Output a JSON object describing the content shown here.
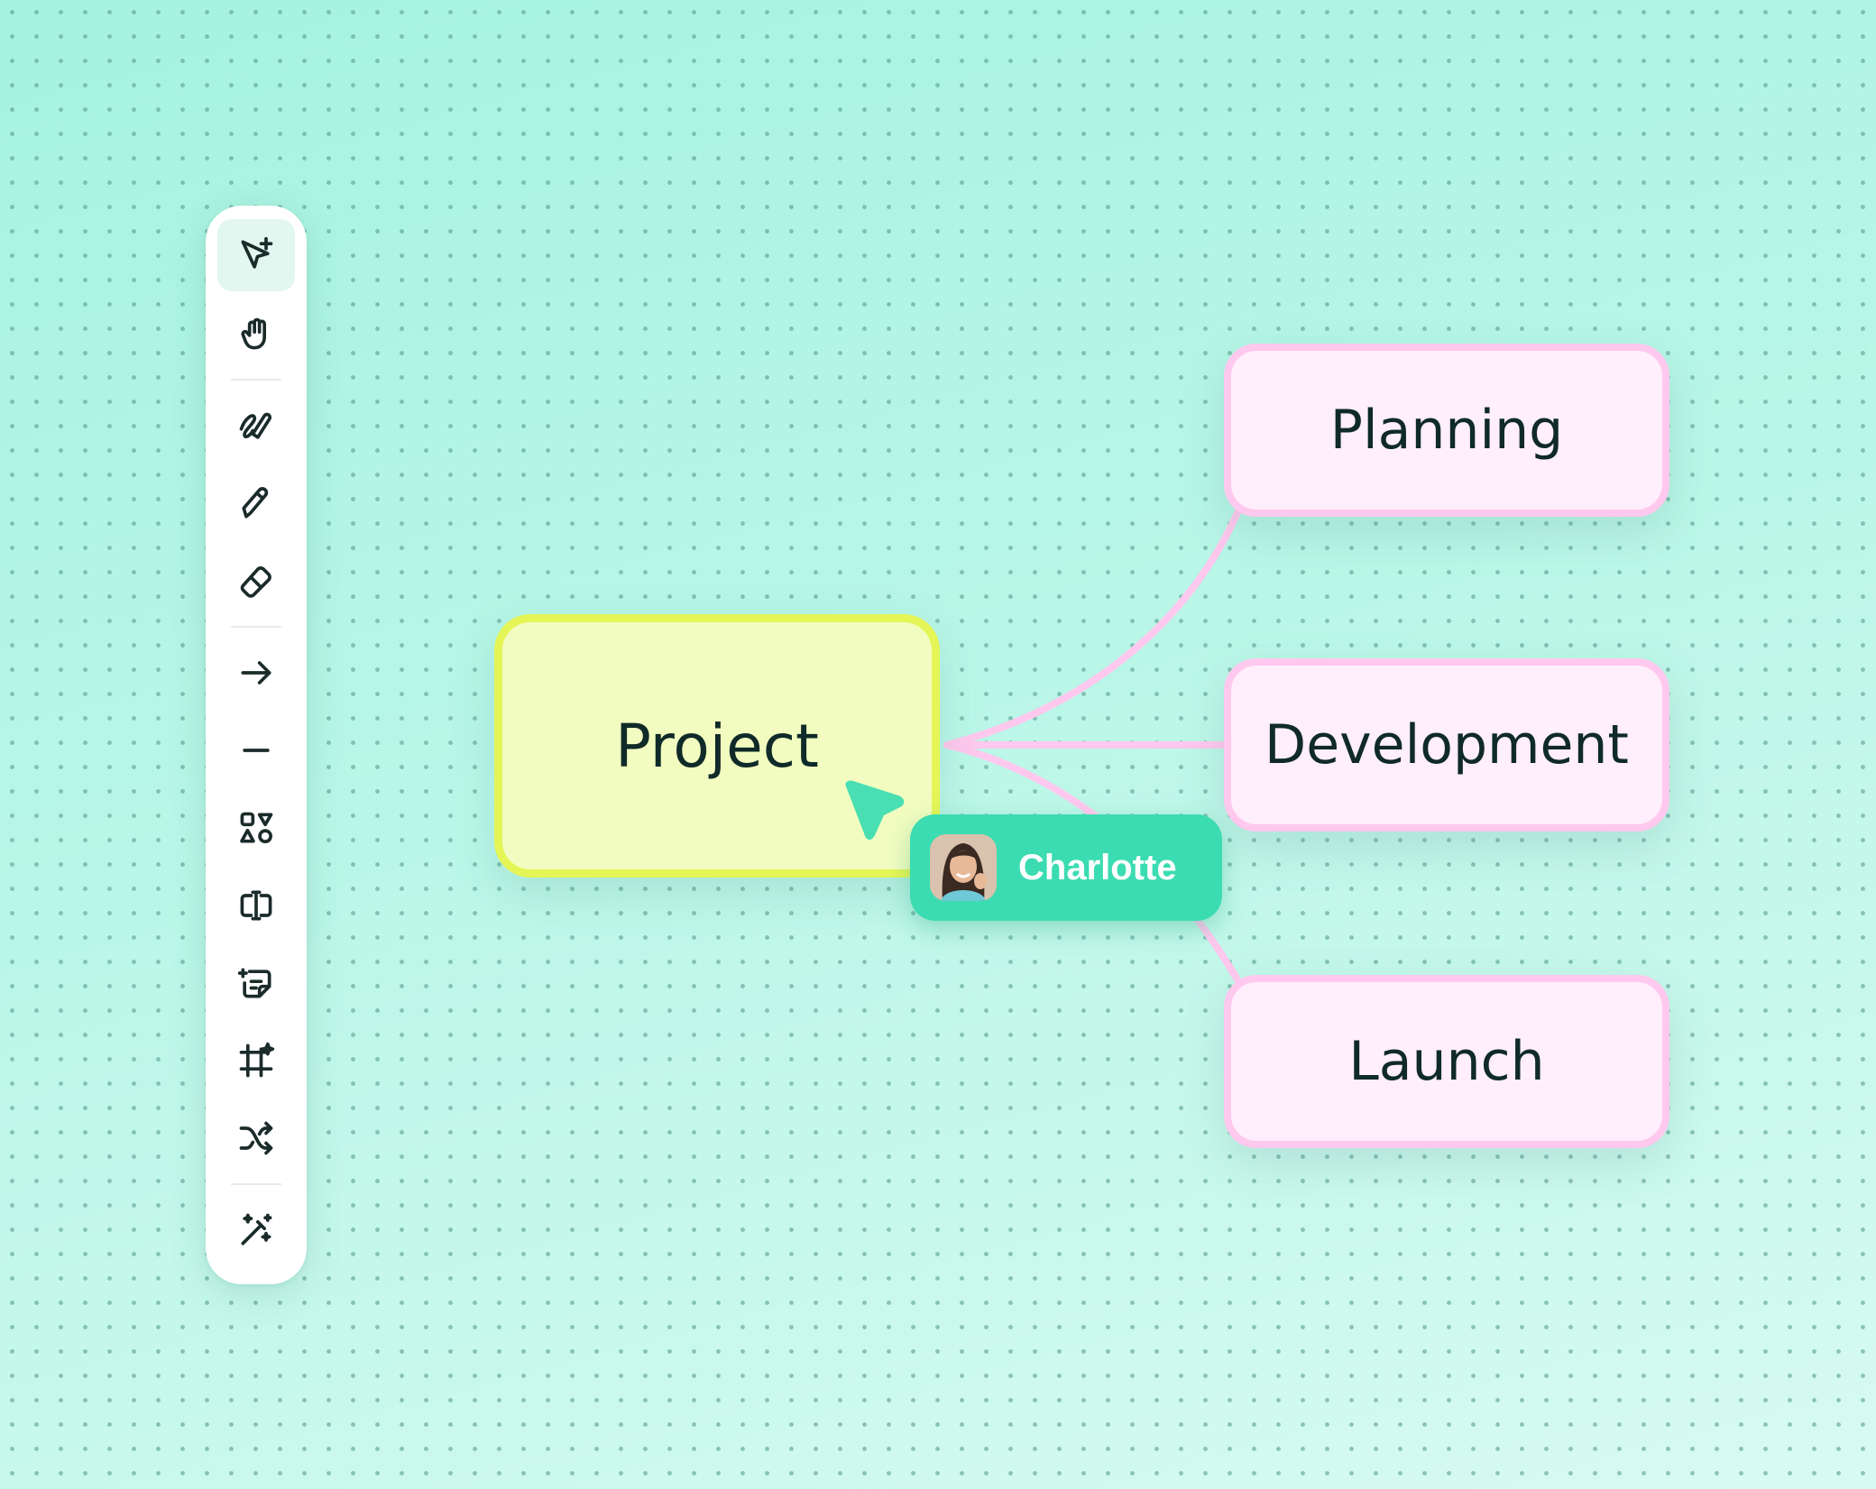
{
  "toolbar": {
    "tools": [
      {
        "icon": "pointer-plus-icon",
        "active": true
      },
      {
        "icon": "hand-icon"
      },
      {
        "icon": "scribble-pen-icon"
      },
      {
        "icon": "pencil-icon"
      },
      {
        "icon": "eraser-icon"
      },
      {
        "icon": "arrow-right-icon"
      },
      {
        "icon": "line-icon"
      },
      {
        "icon": "shapes-icon"
      },
      {
        "icon": "text-box-icon"
      },
      {
        "icon": "sticky-note-icon"
      },
      {
        "icon": "frame-icon"
      },
      {
        "icon": "shuffle-icon"
      },
      {
        "icon": "magic-wand-icon"
      }
    ]
  },
  "mindmap": {
    "root": "Project",
    "children": [
      "Planning",
      "Development",
      "Launch"
    ]
  },
  "collaborator": {
    "name": "Charlotte"
  },
  "colors": {
    "root_fill": "#f2fcc0",
    "root_border": "#e5f556",
    "child_fill": "#ffeefb",
    "child_border": "#ffc8ee",
    "connector": "#ffc8ee",
    "presence": "#3bdcb1"
  }
}
